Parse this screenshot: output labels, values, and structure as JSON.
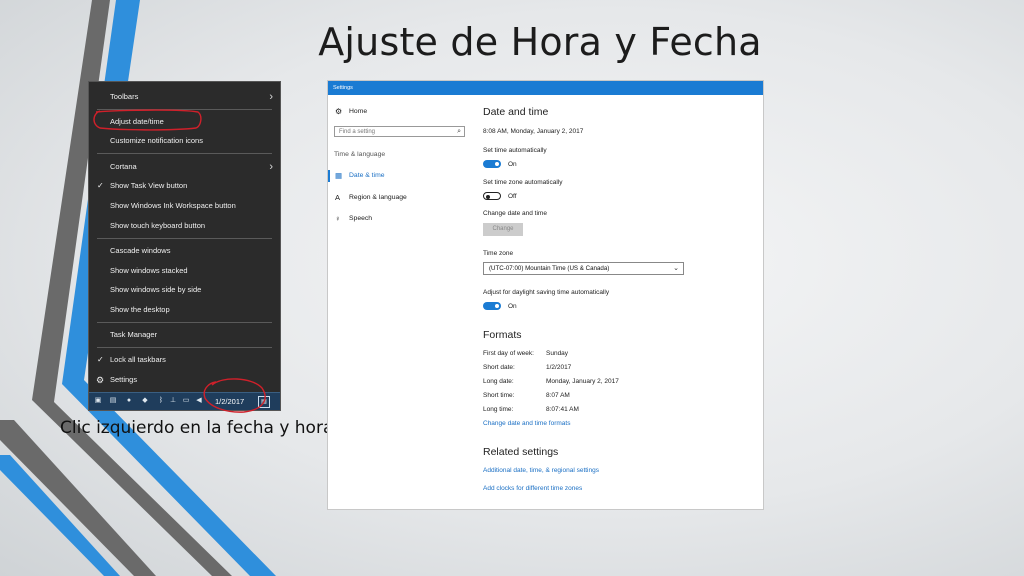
{
  "slide": {
    "title": "Ajuste de Hora y Fecha",
    "caption": "Clic izquierdo en la fecha y hora"
  },
  "context_menu": {
    "items": [
      {
        "label": "Toolbars",
        "submenu": true
      },
      {
        "label": "Adjust date/time"
      },
      {
        "label": "Customize notification icons"
      },
      {
        "label": "Cortana",
        "submenu": true
      },
      {
        "label": "Show Task View button",
        "checked": true
      },
      {
        "label": "Show Windows Ink Workspace button"
      },
      {
        "label": "Show touch keyboard button"
      },
      {
        "label": "Cascade windows"
      },
      {
        "label": "Show windows stacked"
      },
      {
        "label": "Show windows side by side"
      },
      {
        "label": "Show the desktop"
      },
      {
        "label": "Task Manager"
      },
      {
        "label": "Lock all taskbars",
        "checked": true
      },
      {
        "label": "Settings",
        "icon": "gear-icon"
      }
    ],
    "taskbar_date": "1/2/2017",
    "annotation_color": "#d0202a"
  },
  "settings": {
    "window_title": "Settings",
    "nav": {
      "home": "Home",
      "search_placeholder": "Find a setting",
      "group": "Time & language",
      "items": [
        "Date & time",
        "Region & language",
        "Speech"
      ],
      "active": "Date & time"
    },
    "date_time": {
      "heading": "Date and time",
      "current": "8:08 AM, Monday, January 2, 2017",
      "set_time_auto_label": "Set time automatically",
      "set_time_auto_state": "On",
      "set_tz_auto_label": "Set time zone automatically",
      "set_tz_auto_state": "Off",
      "change_label": "Change date and time",
      "change_button": "Change",
      "tz_label": "Time zone",
      "tz_value": "(UTC-07:00) Mountain Time (US & Canada)",
      "dst_label": "Adjust for daylight saving time automatically",
      "dst_state": "On"
    },
    "formats": {
      "heading": "Formats",
      "rows": [
        {
          "label": "First day of week:",
          "value": "Sunday"
        },
        {
          "label": "Short date:",
          "value": "1/2/2017"
        },
        {
          "label": "Long date:",
          "value": "Monday, January 2, 2017"
        },
        {
          "label": "Short time:",
          "value": "8:07 AM"
        },
        {
          "label": "Long time:",
          "value": "8:07:41 AM"
        }
      ],
      "change_link": "Change date and time formats"
    },
    "related": {
      "heading": "Related settings",
      "links": [
        "Additional date, time, & regional settings",
        "Add clocks for different time zones"
      ]
    },
    "accent": "#1a7bd3"
  }
}
